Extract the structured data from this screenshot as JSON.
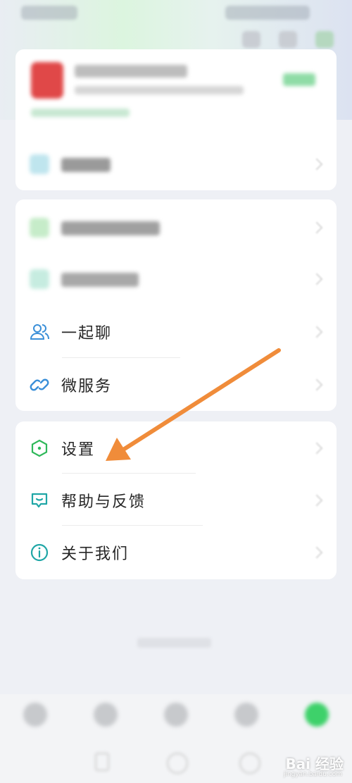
{
  "menu": {
    "items": [
      {
        "key": "yiqiliao",
        "label": "一起聊"
      },
      {
        "key": "weifuwu",
        "label": "微服务"
      }
    ]
  },
  "settings_group": {
    "items": [
      {
        "key": "settings",
        "label": "设置"
      },
      {
        "key": "help",
        "label": "帮助与反馈"
      },
      {
        "key": "about",
        "label": "关于我们"
      }
    ]
  },
  "watermark": {
    "text": "Bai 经验",
    "sub": "jingyan.baidu.com"
  },
  "colors": {
    "accent_green": "#3ed16a",
    "icon_teal": "#1fa6a6",
    "icon_blue": "#3a8fd8",
    "icon_green": "#2fb85a",
    "arrow": "#f08c3a"
  }
}
